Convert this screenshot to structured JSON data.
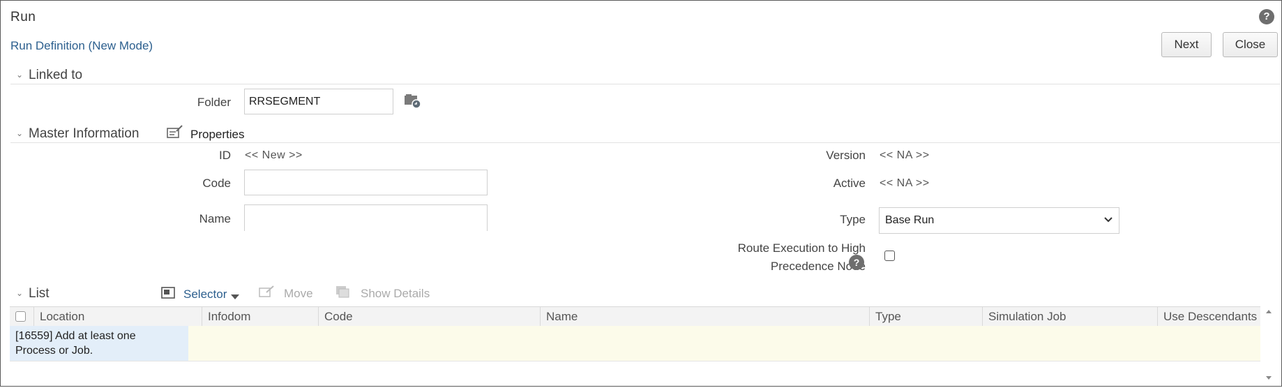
{
  "window": {
    "title": "Run",
    "subtitle": "Run Definition (New Mode)"
  },
  "toolbar": {
    "next_label": "Next",
    "close_label": "Close",
    "help_glyph": "?"
  },
  "linked_to": {
    "section_title": "Linked to",
    "folder_label": "Folder",
    "folder_value": "RRSEGMENT"
  },
  "master_information": {
    "section_title": "Master Information",
    "properties_label": "Properties",
    "id_label": "ID",
    "id_value": "<< New >>",
    "code_label": "Code",
    "code_value": "",
    "name_label": "Name",
    "name_value": "",
    "version_label": "Version",
    "version_value": "<< NA >>",
    "active_label": "Active",
    "active_value": "<< NA >>",
    "type_label": "Type",
    "type_value": "Base Run",
    "route_label_line1": "Route Execution to High",
    "route_label_line2": "Precedence Node",
    "route_checked": false
  },
  "list": {
    "section_title": "List",
    "tools": {
      "selector": "Selector",
      "move": "Move",
      "show_details": "Show Details"
    },
    "columns": [
      "Location",
      "Infodom",
      "Code",
      "Name",
      "Type",
      "Simulation Job",
      "Use Descendants"
    ],
    "message_line1": "[16559] Add at least one",
    "message_line2": "Process or Job."
  },
  "colors": {
    "link": "#2c5f8e",
    "row_highlight": "#fcfbea",
    "message_cell": "#e3eef9"
  }
}
